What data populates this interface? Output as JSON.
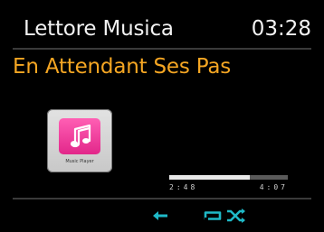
{
  "header": {
    "title": "Lettore Musica",
    "clock": "03:28"
  },
  "now_playing": {
    "track_title": "En Attendant Ses Pas",
    "album_art_caption": "Music Player",
    "elapsed": "2:48",
    "total": "4:07",
    "progress": 0.68
  },
  "status_icons": [
    {
      "name": "previous-arrow-icon",
      "color": "#1fb9c7"
    },
    {
      "name": "repeat-icon",
      "color": "#1fb9c7"
    },
    {
      "name": "shuffle-icon",
      "color": "#1fb9c7"
    }
  ],
  "colors": {
    "background": "#000000",
    "text": "#f2f2f2",
    "accent": "#f5a623",
    "icons": "#1fb9c7"
  }
}
